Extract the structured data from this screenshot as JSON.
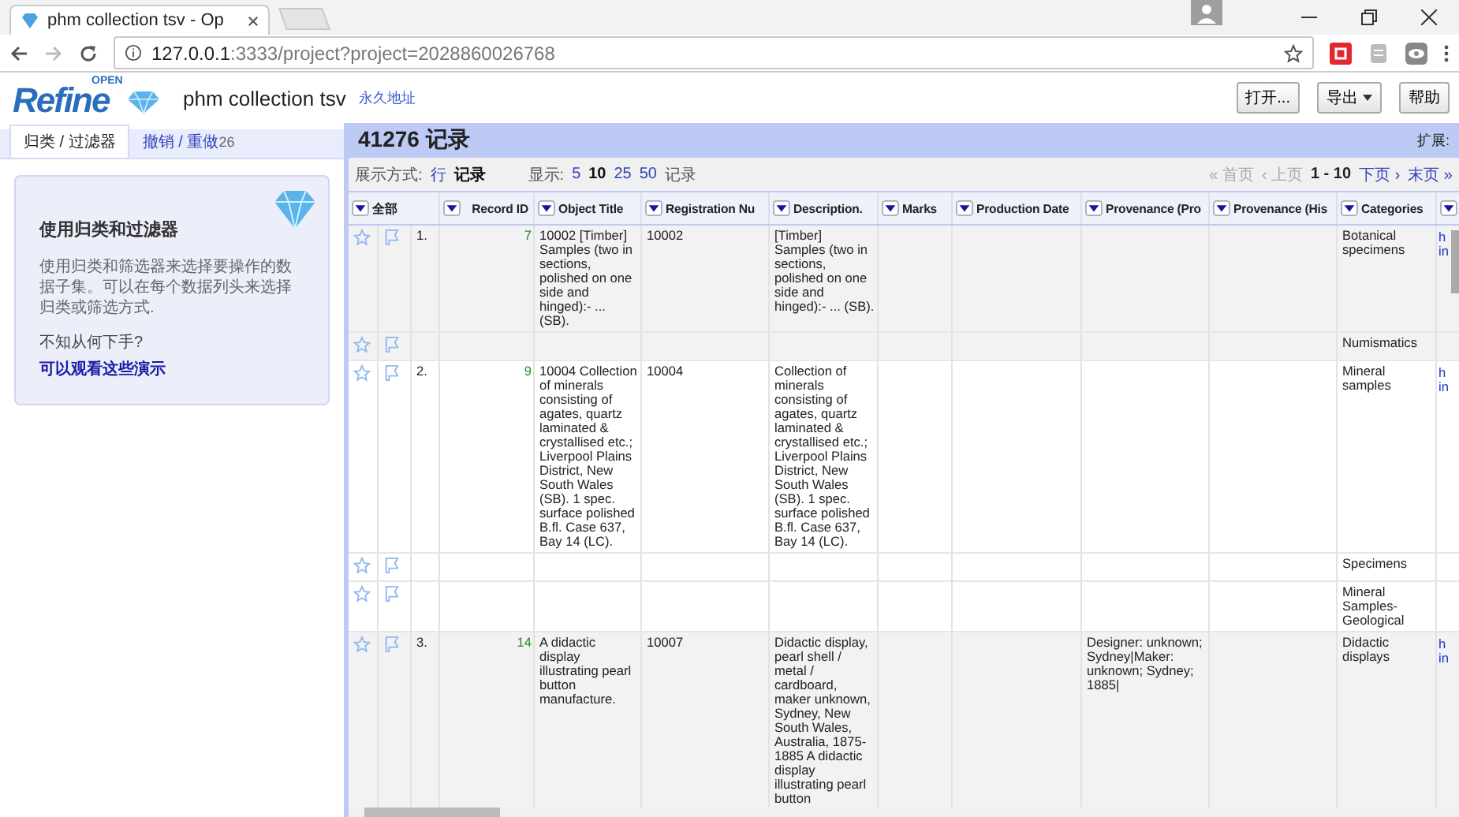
{
  "browser": {
    "tab_title": "phm collection tsv - Op",
    "url_host": "127.0.0.1",
    "url_rest": ":3333/project?project=2028860026768"
  },
  "header": {
    "logo_tag": "OPEN",
    "logo_word": "Refine",
    "project_title": "phm collection tsv",
    "permalink": "永久地址",
    "buttons": [
      {
        "label": "打开...",
        "kind": "plain"
      },
      {
        "label": "导出",
        "kind": "menu"
      },
      {
        "label": "帮助",
        "kind": "plain"
      }
    ]
  },
  "left_panel": {
    "tabs": [
      {
        "label": "归类 / 过滤器",
        "selected": true
      },
      {
        "label": "撤销 / 重做",
        "count": "26",
        "selected": false
      }
    ],
    "card": {
      "title": "使用归类和过滤器",
      "text": "使用归类和筛选器来选择要操作的数据子集。可以在每个数据列头来选择归类或筛选方式.",
      "question": "不知从何下手?",
      "link": "可以观看这些演示"
    }
  },
  "summary": {
    "count": "41276",
    "unit": "记录",
    "extensions": "扩展:"
  },
  "view_options": {
    "mode_label": "展示方式:",
    "modes": [
      {
        "label": "行",
        "selected": false
      },
      {
        "label": "记录",
        "selected": true
      }
    ],
    "show_label": "显示:",
    "page_sizes": [
      {
        "label": "5",
        "selected": false
      },
      {
        "label": "10",
        "selected": true
      },
      {
        "label": "25",
        "selected": false
      },
      {
        "label": "50",
        "selected": false
      }
    ],
    "show_unit": "记录",
    "pager": [
      {
        "label": "« 首页",
        "disabled": true
      },
      {
        "label": "‹ 上页",
        "disabled": true
      },
      {
        "label": "1 - 10",
        "kind": "range"
      },
      {
        "label": "下页 ›",
        "disabled": false
      },
      {
        "label": "末页 »",
        "disabled": false
      }
    ]
  },
  "table": {
    "columns": [
      "全部",
      "Record ID",
      "Object Title",
      "Registration Nu",
      "Description.",
      "Marks",
      "Production Date",
      "Provenance (Pro",
      "Provenance (His",
      "Categories"
    ],
    "records": [
      {
        "index": "1.",
        "record_id": "7",
        "rows": [
          {
            "starred": false,
            "flagged": false,
            "object_title": "10002 [Timber] Samples (two in sections, polished on one side and hinged):- ... (SB).",
            "registration_number": "10002",
            "description": "[Timber] Samples (two in sections, polished on one side and hinged):- ... (SB).",
            "categories": "Botanical specimens",
            "column_13": "h in"
          },
          {
            "starred": false,
            "flagged": false,
            "categories": "Numismatics"
          }
        ]
      },
      {
        "index": "2.",
        "record_id": "9",
        "rows": [
          {
            "starred": false,
            "flagged": false,
            "object_title": "10004 Collection of minerals consisting of agates, quartz laminated & crystallised etc.; Liverpool Plains District, New South Wales (SB). 1 spec. surface polished B.fl. Case 637, Bay 14 (LC).",
            "registration_number": "10004",
            "description": "Collection of minerals consisting of agates, quartz laminated & crystallised etc.; Liverpool Plains District, New South Wales (SB). 1 spec. surface polished B.fl. Case 637, Bay 14 (LC).",
            "categories": "Mineral samples",
            "column_13": "h in"
          },
          {
            "starred": false,
            "flagged": false,
            "categories": "Specimens"
          },
          {
            "starred": false,
            "flagged": false,
            "categories": "Mineral Samples-Geological"
          }
        ]
      },
      {
        "index": "3.",
        "record_id": "14",
        "rows": [
          {
            "starred": false,
            "flagged": false,
            "object_title": "A didactic display illustrating pearl button manufacture.",
            "registration_number": "10007",
            "description": "Didactic display, pearl shell / metal / cardboard, maker unknown, Sydney, New South Wales, Australia, 1875-1885 A didactic display illustrating pearl button",
            "provenance_pro": "Designer: unknown; Sydney|Maker: unknown; Sydney; 1885|",
            "categories": "Didactic displays",
            "column_13": "h in"
          }
        ]
      }
    ]
  }
}
